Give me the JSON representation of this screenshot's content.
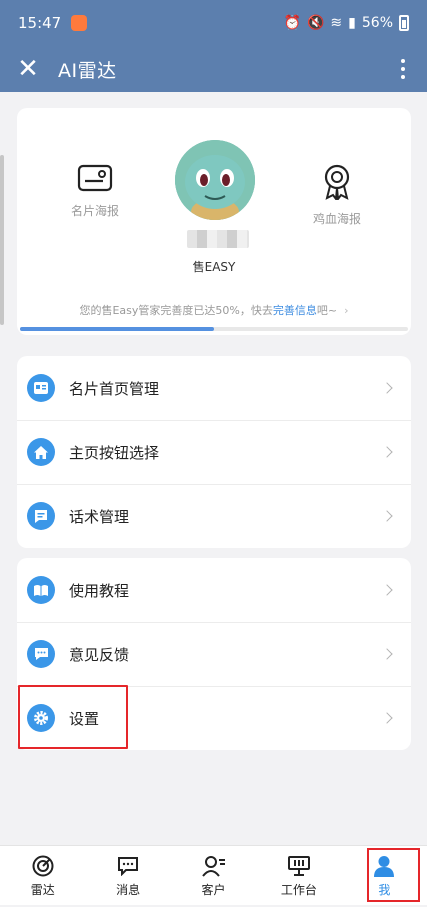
{
  "status_bar": {
    "time": "15:47",
    "battery": "56%"
  },
  "title_bar": {
    "close_icon": "close-icon",
    "title": "AI雷达",
    "more_icon": "more-vertical-icon"
  },
  "profile": {
    "left_poster_label": "名片海报",
    "right_poster_label": "鸡血海报",
    "company": "售EASY",
    "progress_prefix": "您的售Easy管家完善度已达50%，快去",
    "progress_link": "完善信息",
    "progress_suffix": "吧~",
    "progress_percent": 50
  },
  "menu_group_1": [
    {
      "label": "名片首页管理",
      "icon": "card-icon"
    },
    {
      "label": "主页按钮选择",
      "icon": "home-icon"
    },
    {
      "label": "话术管理",
      "icon": "script-icon"
    }
  ],
  "menu_group_2": [
    {
      "label": "使用教程",
      "icon": "book-icon"
    },
    {
      "label": "意见反馈",
      "icon": "feedback-icon"
    },
    {
      "label": "设置",
      "icon": "gear-icon"
    }
  ],
  "bottom_nav": [
    {
      "label": "雷达",
      "icon": "radar-icon"
    },
    {
      "label": "消息",
      "icon": "message-icon"
    },
    {
      "label": "客户",
      "icon": "customer-icon"
    },
    {
      "label": "工作台",
      "icon": "workbench-icon"
    },
    {
      "label": "我",
      "icon": "person-icon",
      "active": true
    }
  ],
  "colors": {
    "header": "#5c7fae",
    "accent": "#3b97e8",
    "highlight": "#e5262a"
  }
}
